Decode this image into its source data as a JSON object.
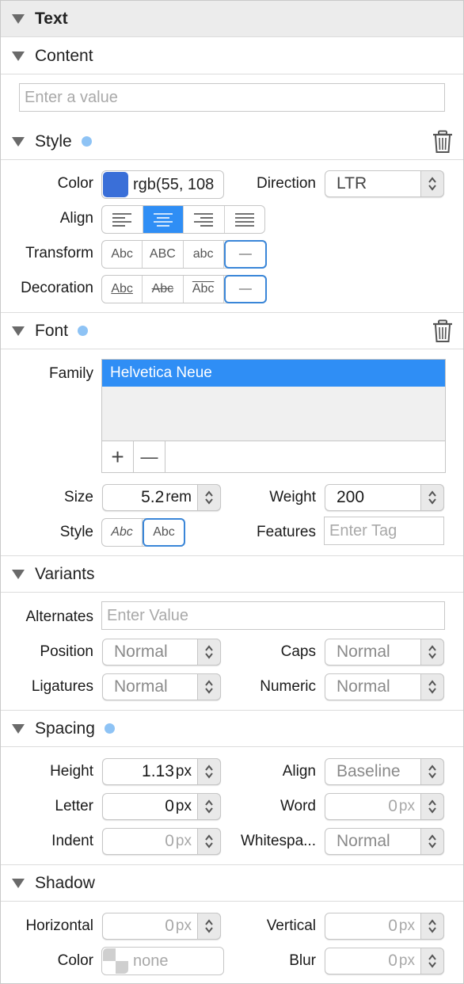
{
  "header": {
    "title": "Text"
  },
  "content": {
    "title": "Content",
    "input_placeholder": "Enter a value"
  },
  "style": {
    "title": "Style",
    "color_label": "Color",
    "color_value": "rgb(55, 108",
    "color_swatch": "#3a6fd8",
    "direction_label": "Direction",
    "direction_value": "LTR",
    "align_label": "Align",
    "align_options": [
      "left",
      "center",
      "right",
      "justify"
    ],
    "align_selected": "center",
    "transform_label": "Transform",
    "transform_options": [
      "Abc",
      "ABC",
      "abc",
      "—"
    ],
    "decoration_label": "Decoration",
    "decoration_options": [
      "Abc",
      "Abc",
      "Abc",
      "—"
    ]
  },
  "font": {
    "title": "Font",
    "family_label": "Family",
    "family_selected": "Helvetica Neue",
    "add_label": "+",
    "remove_label": "—",
    "size_label": "Size",
    "size_value": "5.2",
    "size_unit": "rem",
    "weight_label": "Weight",
    "weight_value": "200",
    "style_label": "Style",
    "style_options": [
      "Abc",
      "Abc"
    ],
    "features_label": "Features",
    "features_placeholder": "Enter Tag"
  },
  "variants": {
    "title": "Variants",
    "alternates_label": "Alternates",
    "alternates_placeholder": "Enter Value",
    "position_label": "Position",
    "position_value": "Normal",
    "caps_label": "Caps",
    "caps_value": "Normal",
    "ligatures_label": "Ligatures",
    "ligatures_value": "Normal",
    "numeric_label": "Numeric",
    "numeric_value": "Normal"
  },
  "spacing": {
    "title": "Spacing",
    "height_label": "Height",
    "height_value": "1.13",
    "height_unit": "px",
    "align_label": "Align",
    "align_value": "Baseline",
    "letter_label": "Letter",
    "letter_value": "0",
    "letter_unit": "px",
    "word_label": "Word",
    "word_value": "0",
    "word_unit": "px",
    "indent_label": "Indent",
    "indent_value": "0",
    "indent_unit": "px",
    "whitespace_label": "Whitespa...",
    "whitespace_value": "Normal"
  },
  "shadow": {
    "title": "Shadow",
    "horizontal_label": "Horizontal",
    "horizontal_value": "0",
    "horizontal_unit": "px",
    "vertical_label": "Vertical",
    "vertical_value": "0",
    "vertical_unit": "px",
    "color_label": "Color",
    "color_value": "none",
    "blur_label": "Blur",
    "blur_value": "0",
    "blur_unit": "px"
  },
  "colors": {
    "accent": "#2f8ef5",
    "dot": "#8ec3f5"
  }
}
